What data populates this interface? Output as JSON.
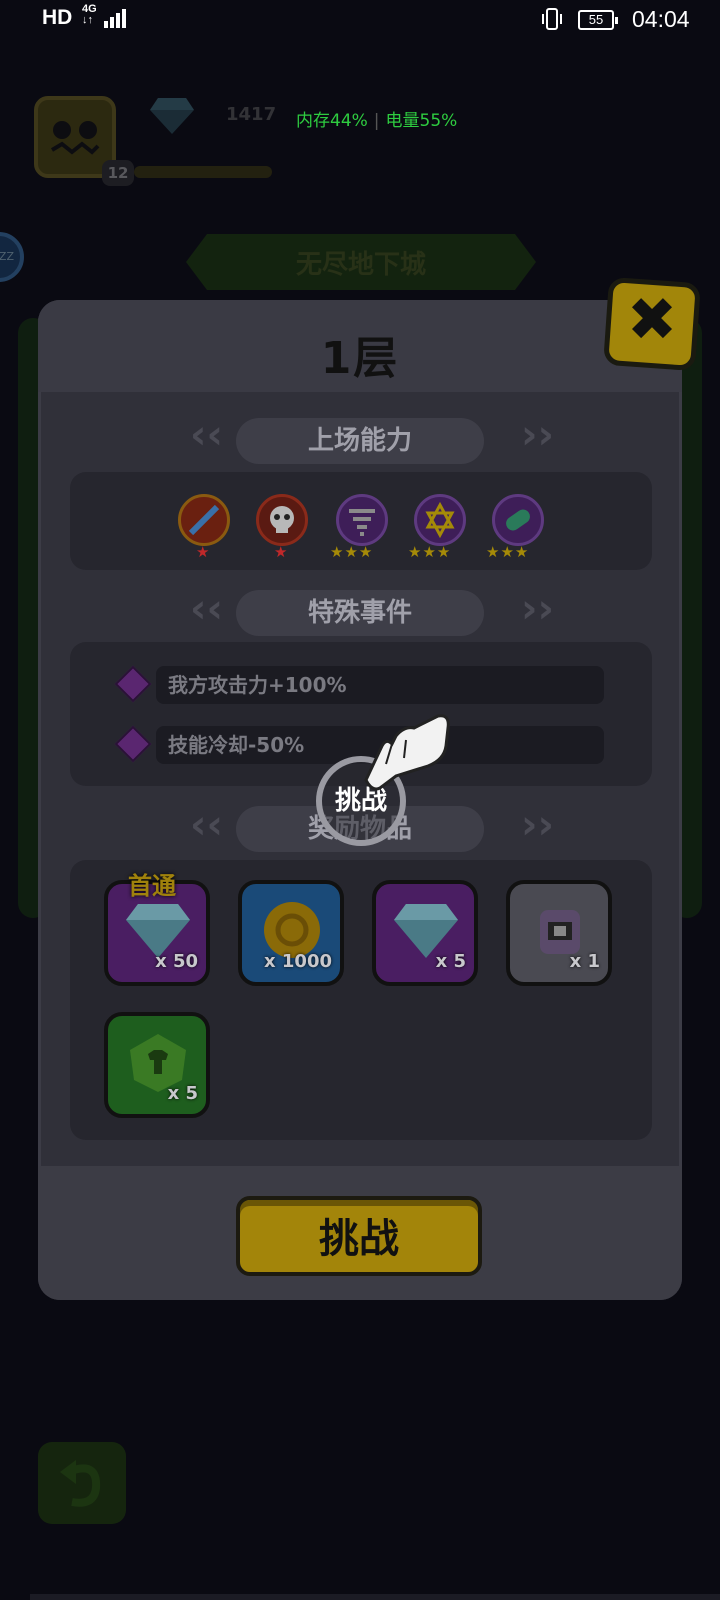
{
  "status_bar": {
    "hd": "HD",
    "network": "4G",
    "battery": "55",
    "time": "04:04"
  },
  "hud": {
    "gem_count": "1417",
    "player_level": "12",
    "memory_label": "内存44%",
    "battery_label": "电量55%",
    "side_badge": "ZZ"
  },
  "background": {
    "mode_title": "无尽地下城"
  },
  "modal": {
    "title": "1层",
    "abilities_title": "上场能力",
    "abilities": [
      {
        "icon": "compass-sword-icon",
        "stars": 1,
        "star_color": "#c0282a"
      },
      {
        "icon": "skull-icon",
        "stars": 1,
        "star_color": "#c0282a"
      },
      {
        "icon": "tornado-icon",
        "stars": 3,
        "star_color": "#a58a08"
      },
      {
        "icon": "hexagram-icon",
        "stars": 3,
        "star_color": "#a58a08"
      },
      {
        "icon": "pill-icon",
        "stars": 3,
        "star_color": "#a58a08"
      }
    ],
    "events_title": "特殊事件",
    "events": [
      {
        "text": "我方攻击力+100%"
      },
      {
        "text": "技能冷却-50%"
      }
    ],
    "rewards_title": "奖励物品",
    "first_clear_tag": "首通",
    "rewards": [
      {
        "icon": "diamond-icon",
        "qty": "x 50",
        "frame": "purple"
      },
      {
        "icon": "gold-coin-icon",
        "qty": "x 1000",
        "frame": "blue"
      },
      {
        "icon": "diamond-icon",
        "qty": "x 5",
        "frame": "purple"
      },
      {
        "icon": "robot-chest-icon",
        "qty": "x 1",
        "frame": "gray"
      },
      {
        "icon": "shirt-token-icon",
        "qty": "x 5",
        "frame": "green"
      }
    ],
    "challenge_label": "挑战"
  },
  "tutorial": {
    "ring_label": "挑战"
  }
}
